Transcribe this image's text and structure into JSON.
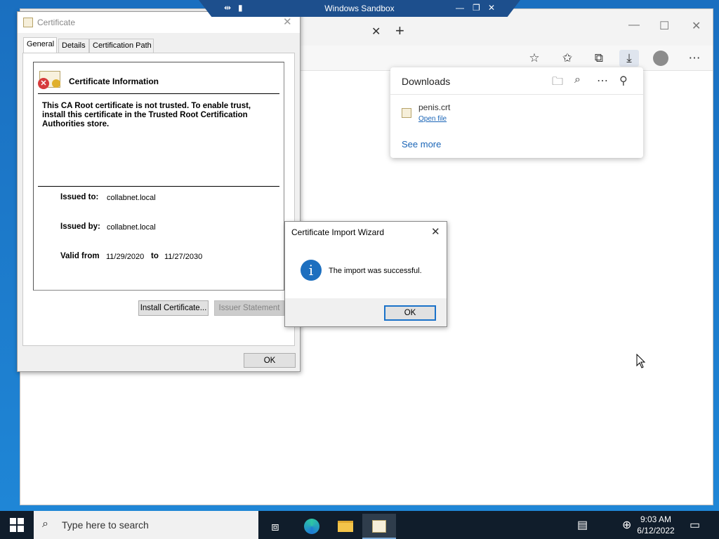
{
  "sandbox": {
    "title": "Windows Sandbox"
  },
  "browser": {
    "tab_close": "✕",
    "new_tab": "+",
    "win_min": "—",
    "win_max": "☐",
    "win_close": "✕"
  },
  "downloads": {
    "title": "Downloads",
    "items": [
      {
        "file": "penis.crt",
        "action": "Open file"
      }
    ],
    "see_more": "See more"
  },
  "certificate": {
    "window_title": "Certificate",
    "tabs": [
      "General",
      "Details",
      "Certification Path"
    ],
    "info_title": "Certificate Information",
    "warning": "This CA Root certificate is not trusted. To enable trust, install this certificate in the Trusted Root Certification Authorities store.",
    "issued_to_label": "Issued to:",
    "issued_to": "collabnet.local",
    "issued_by_label": "Issued by:",
    "issued_by": "collabnet.local",
    "valid_from_label": "Valid from",
    "valid_from": "11/29/2020",
    "to_label": "to",
    "valid_to": "11/27/2030",
    "install_button": "Install Certificate...",
    "issuer_button": "Issuer Statement",
    "ok_button": "OK"
  },
  "wizard": {
    "title": "Certificate Import Wizard",
    "message": "The import was successful.",
    "ok_button": "OK"
  },
  "taskbar": {
    "search_placeholder": "Type here to search",
    "time": "9:03 AM",
    "date": "6/12/2022"
  }
}
